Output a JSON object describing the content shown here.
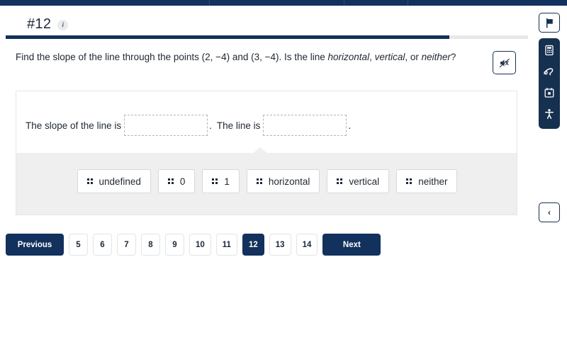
{
  "colors": {
    "navy": "#12315c",
    "rail_navy": "#16304f",
    "tray_gray": "#efefef",
    "dashed_border": "#b2b4b7"
  },
  "topbar": {
    "segments": [
      "segment-1",
      "segment-2",
      "segment-3",
      "segment-4"
    ]
  },
  "header": {
    "question_number": "#12",
    "info_glyph": "i",
    "progress_percent": 85
  },
  "question": {
    "part1": "Find the slope of the line through the points (2, −4) and (3, −4). Is the line ",
    "em1": "horizontal",
    "sep1": ", ",
    "em2": "vertical",
    "sep2": ", or ",
    "em3": "neither",
    "end": "?",
    "audio_button_label": "audio-muted"
  },
  "answer_area": {
    "lead_text": "The slope of the line is",
    "period_1": ".",
    "middle_text": "The line is",
    "period_2": ".",
    "dropzone_1_value": "",
    "dropzone_2_value": ""
  },
  "tray": {
    "tiles": [
      {
        "label": "undefined"
      },
      {
        "label": "0"
      },
      {
        "label": "1"
      },
      {
        "label": "horizontal"
      },
      {
        "label": "vertical"
      },
      {
        "label": "neither"
      }
    ]
  },
  "pagination": {
    "previous_label": "Previous",
    "next_label": "Next",
    "pages": [
      "5",
      "6",
      "7",
      "8",
      "9",
      "10",
      "11",
      "12",
      "13",
      "14"
    ],
    "active_page": "12"
  },
  "right_rail": {
    "flag_icon": "flag-icon",
    "tools": [
      "calculator-icon",
      "draw-icon",
      "calendar-icon",
      "accessibility-icon"
    ],
    "collapse_glyph": "‹"
  }
}
